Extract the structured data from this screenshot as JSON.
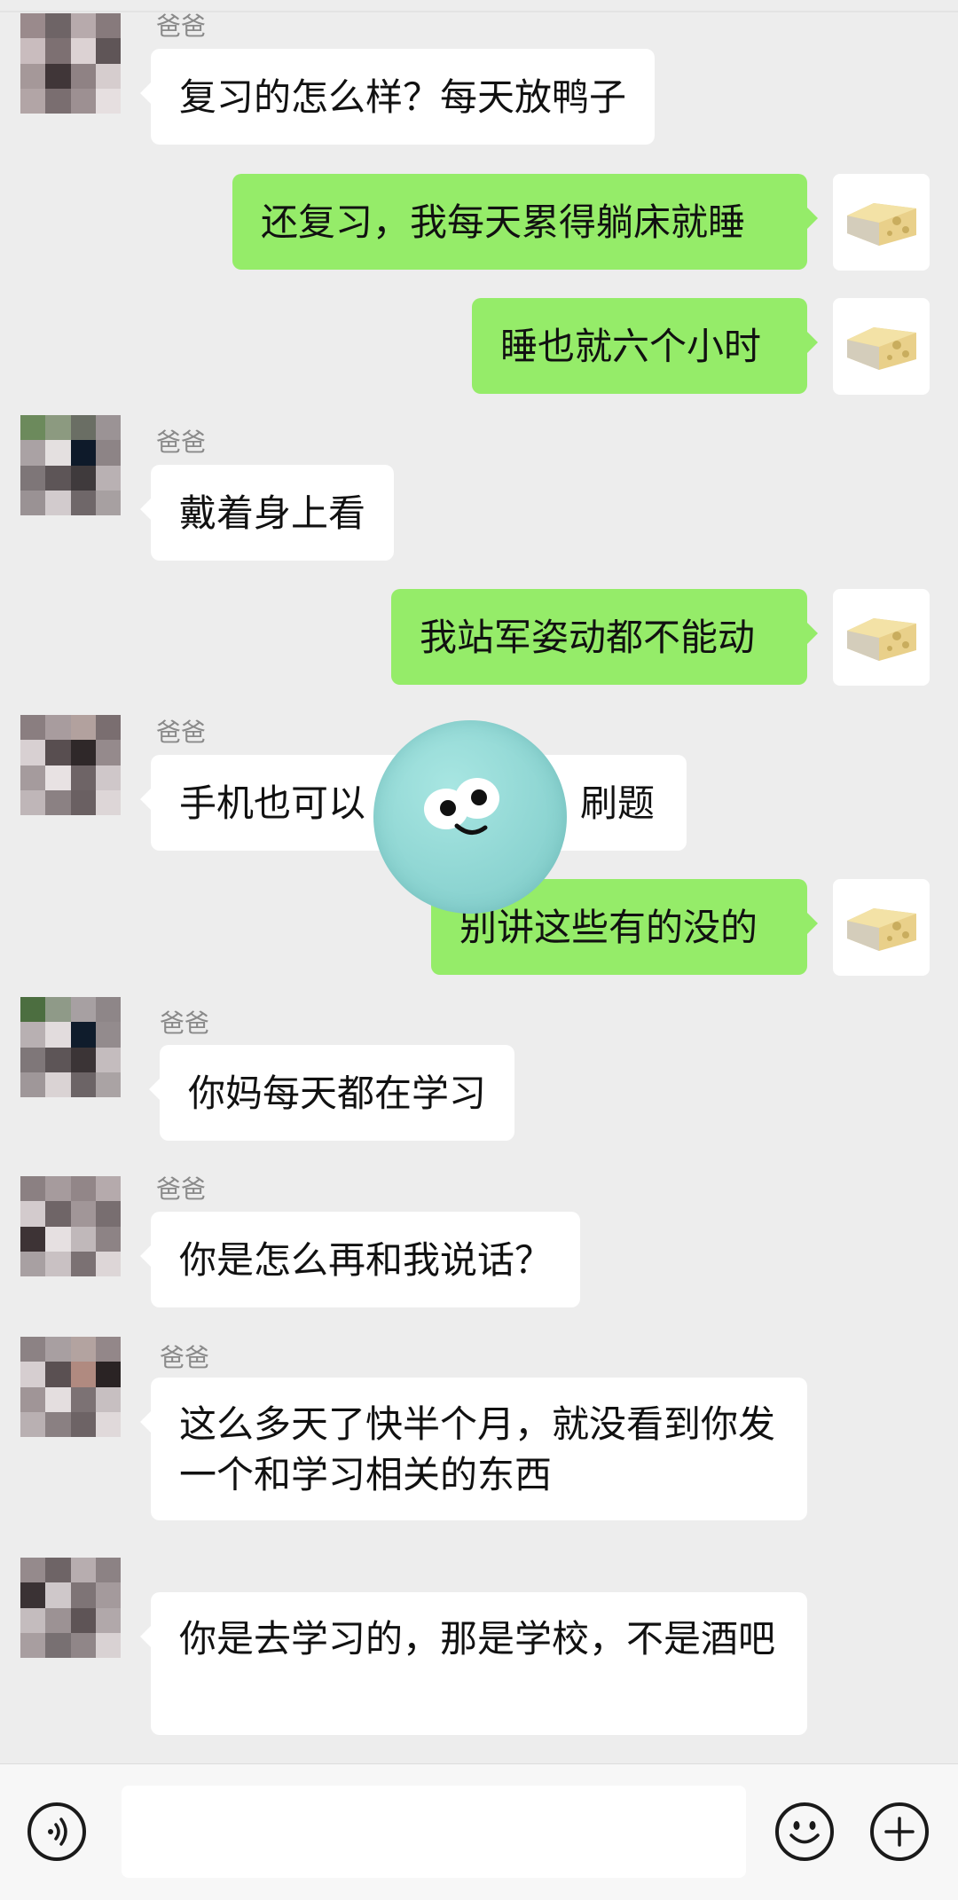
{
  "messages": [
    {
      "dir": "in",
      "sender": "爸爸",
      "text": "复习的怎么样？每天放鸭子"
    },
    {
      "dir": "out",
      "text": "还复习，我每天累得躺床就睡"
    },
    {
      "dir": "out",
      "text": "睡也就六个小时"
    },
    {
      "dir": "in",
      "sender": "爸爸",
      "text": "戴着身上看"
    },
    {
      "dir": "out",
      "text": "我站军姿动都不能动"
    },
    {
      "dir": "in",
      "sender": "爸爸",
      "text": "手机也可以",
      "text_tail": "刷题"
    },
    {
      "dir": "out",
      "text": "别讲这些有的没的"
    },
    {
      "dir": "in",
      "sender": "爸爸",
      "text": "你妈每天都在学习"
    },
    {
      "dir": "in",
      "sender": "爸爸",
      "text": "你是怎么再和我说话？"
    },
    {
      "dir": "in",
      "sender": "爸爸",
      "text": "这么多天了快半个月，就没看到你发一个和学习相关的东西"
    },
    {
      "dir": "in",
      "sender": "",
      "text": "你是去学习的，那是学校，不是酒吧"
    }
  ],
  "input": {
    "value": ""
  },
  "icons": {
    "voice": "voice-icon",
    "emoji": "emoji-icon",
    "plus": "plus-icon",
    "self_avatar": "cheese-icon",
    "sticker": "smiling-blob-sticker"
  },
  "colors": {
    "background": "#ededed",
    "incoming_bubble": "#ffffff",
    "outgoing_bubble": "#95ec69",
    "sender_name": "#8a8a8a"
  }
}
